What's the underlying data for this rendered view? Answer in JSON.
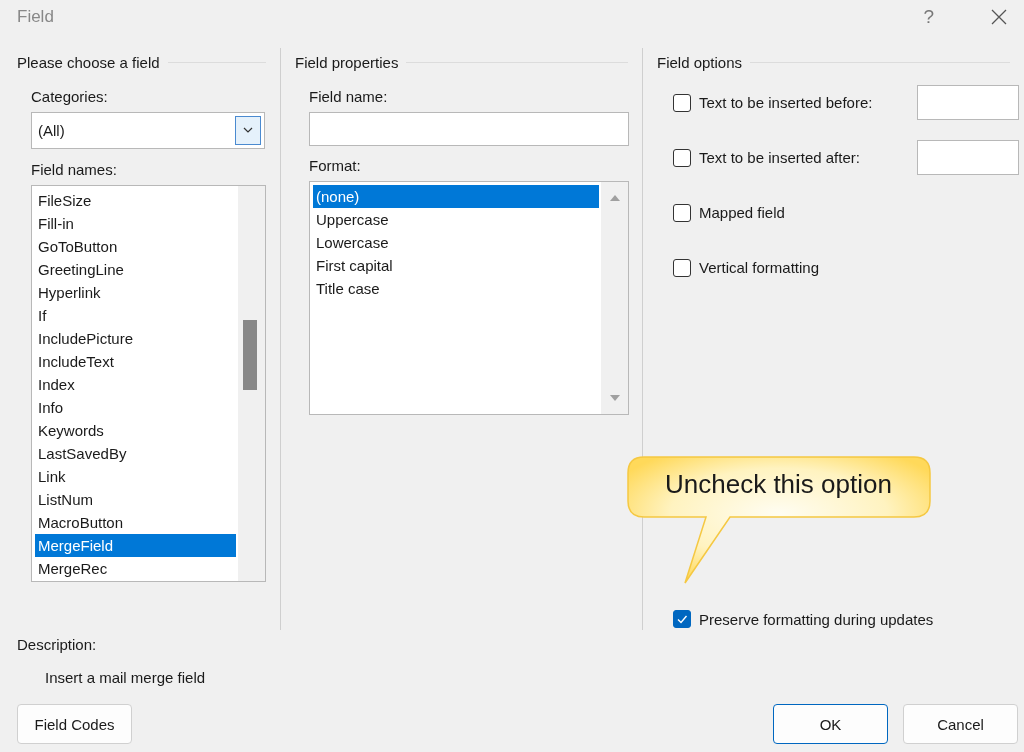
{
  "window": {
    "title": "Field",
    "help": "?"
  },
  "left": {
    "heading": "Please choose a field",
    "categories_label": "Categories:",
    "categories_value": "(All)",
    "field_names_label": "Field names:",
    "field_names": [
      {
        "label": "FileSize",
        "selected": false
      },
      {
        "label": "Fill-in",
        "selected": false
      },
      {
        "label": "GoToButton",
        "selected": false
      },
      {
        "label": "GreetingLine",
        "selected": false
      },
      {
        "label": "Hyperlink",
        "selected": false
      },
      {
        "label": "If",
        "selected": false
      },
      {
        "label": "IncludePicture",
        "selected": false
      },
      {
        "label": "IncludeText",
        "selected": false
      },
      {
        "label": "Index",
        "selected": false
      },
      {
        "label": "Info",
        "selected": false
      },
      {
        "label": "Keywords",
        "selected": false
      },
      {
        "label": "LastSavedBy",
        "selected": false
      },
      {
        "label": "Link",
        "selected": false
      },
      {
        "label": "ListNum",
        "selected": false
      },
      {
        "label": "MacroButton",
        "selected": false
      },
      {
        "label": "MergeField",
        "selected": true
      },
      {
        "label": "MergeRec",
        "selected": false
      }
    ]
  },
  "middle": {
    "heading": "Field properties",
    "field_name_label": "Field name:",
    "format_label": "Format:",
    "formats": [
      {
        "label": "(none)",
        "selected": true
      },
      {
        "label": "Uppercase",
        "selected": false
      },
      {
        "label": "Lowercase",
        "selected": false
      },
      {
        "label": "First capital",
        "selected": false
      },
      {
        "label": "Title case",
        "selected": false
      }
    ]
  },
  "right": {
    "heading": "Field options",
    "options": [
      {
        "kind": "text",
        "label": "Text to be inserted before:",
        "checked": false
      },
      {
        "kind": "text",
        "label": "Text to be inserted after:",
        "checked": false
      },
      {
        "kind": "plain",
        "label": "Mapped field",
        "checked": false
      },
      {
        "kind": "plain",
        "label": "Vertical formatting",
        "checked": false
      }
    ],
    "preserve": {
      "label": "Preserve formatting during updates",
      "checked": true
    }
  },
  "callout": {
    "text": "Uncheck this option"
  },
  "description": {
    "label": "Description:",
    "text": "Insert a mail merge field"
  },
  "buttons": [
    {
      "kind": "normal",
      "label": "Field Codes"
    },
    {
      "kind": "default",
      "label": "OK"
    },
    {
      "kind": "normal",
      "label": "Cancel"
    }
  ]
}
